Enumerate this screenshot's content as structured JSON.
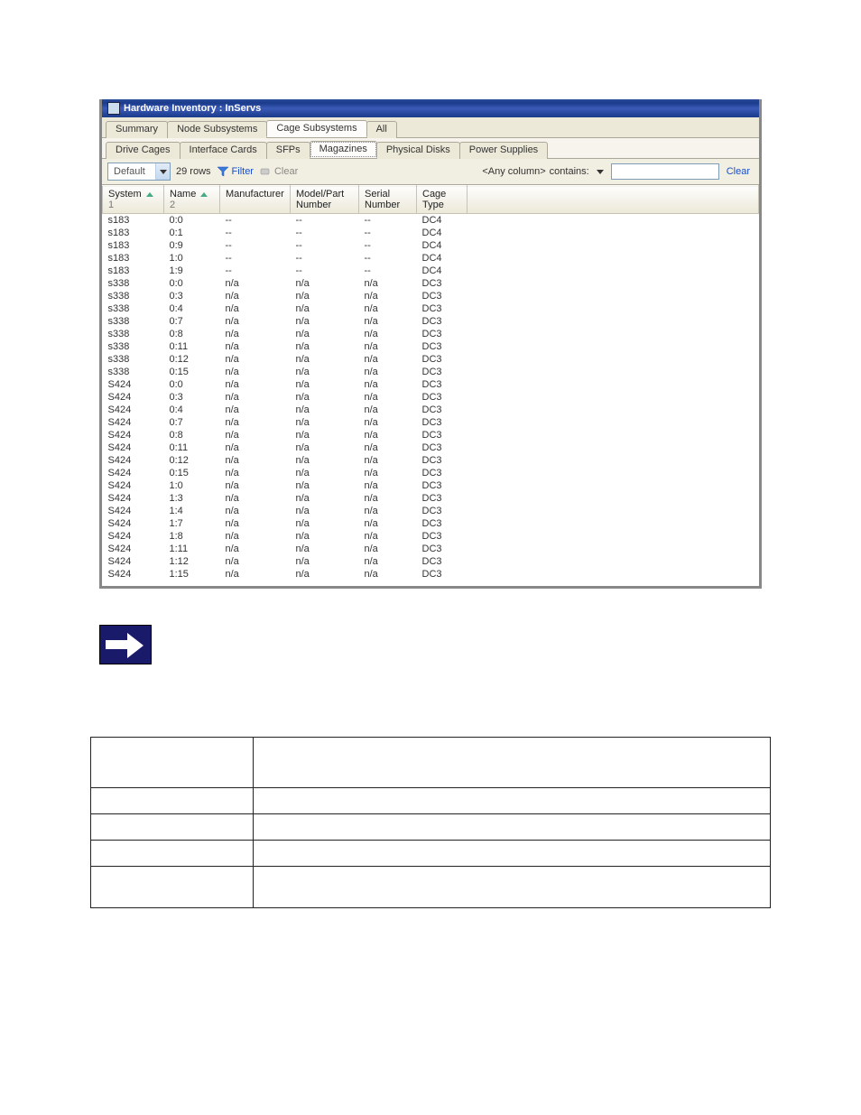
{
  "window": {
    "title": "Hardware Inventory : InServs"
  },
  "tabs1": {
    "items": [
      {
        "label": "Summary"
      },
      {
        "label": "Node Subsystems"
      },
      {
        "label": "Cage Subsystems"
      },
      {
        "label": "All"
      }
    ],
    "activeIndex": 2
  },
  "tabs2": {
    "items": [
      {
        "label": "Drive Cages"
      },
      {
        "label": "Interface Cards"
      },
      {
        "label": "SFPs"
      },
      {
        "label": "Magazines"
      },
      {
        "label": "Physical Disks"
      },
      {
        "label": "Power Supplies"
      }
    ],
    "activeIndex": 3
  },
  "toolbar": {
    "view": "Default",
    "rows_label": "29 rows",
    "filter_label": "Filter",
    "clear_label": "Clear",
    "filter_scope": "<Any column>",
    "filter_op": "contains:",
    "filter_value": "",
    "clear_link": "Clear"
  },
  "grid": {
    "columns": [
      {
        "label": "System",
        "sort": "1"
      },
      {
        "label": "Name",
        "sort": "2"
      },
      {
        "label": "Manufacturer"
      },
      {
        "label": "Model/Part Number"
      },
      {
        "label": "Serial Number"
      },
      {
        "label": "Cage Type"
      }
    ],
    "rows": [
      {
        "c": [
          "s183",
          "0:0",
          "--",
          "--",
          "--",
          "DC4"
        ]
      },
      {
        "c": [
          "s183",
          "0:1",
          "--",
          "--",
          "--",
          "DC4"
        ]
      },
      {
        "c": [
          "s183",
          "0:9",
          "--",
          "--",
          "--",
          "DC4"
        ]
      },
      {
        "c": [
          "s183",
          "1:0",
          "--",
          "--",
          "--",
          "DC4"
        ]
      },
      {
        "c": [
          "s183",
          "1:9",
          "--",
          "--",
          "--",
          "DC4"
        ]
      },
      {
        "c": [
          "s338",
          "0:0",
          "n/a",
          "n/a",
          "n/a",
          "DC3"
        ]
      },
      {
        "c": [
          "s338",
          "0:3",
          "n/a",
          "n/a",
          "n/a",
          "DC3"
        ]
      },
      {
        "c": [
          "s338",
          "0:4",
          "n/a",
          "n/a",
          "n/a",
          "DC3"
        ]
      },
      {
        "c": [
          "s338",
          "0:7",
          "n/a",
          "n/a",
          "n/a",
          "DC3"
        ]
      },
      {
        "c": [
          "s338",
          "0:8",
          "n/a",
          "n/a",
          "n/a",
          "DC3"
        ]
      },
      {
        "c": [
          "s338",
          "0:11",
          "n/a",
          "n/a",
          "n/a",
          "DC3"
        ]
      },
      {
        "c": [
          "s338",
          "0:12",
          "n/a",
          "n/a",
          "n/a",
          "DC3"
        ]
      },
      {
        "c": [
          "s338",
          "0:15",
          "n/a",
          "n/a",
          "n/a",
          "DC3"
        ]
      },
      {
        "c": [
          "S424",
          "0:0",
          "n/a",
          "n/a",
          "n/a",
          "DC3"
        ]
      },
      {
        "c": [
          "S424",
          "0:3",
          "n/a",
          "n/a",
          "n/a",
          "DC3"
        ]
      },
      {
        "c": [
          "S424",
          "0:4",
          "n/a",
          "n/a",
          "n/a",
          "DC3"
        ]
      },
      {
        "c": [
          "S424",
          "0:7",
          "n/a",
          "n/a",
          "n/a",
          "DC3"
        ]
      },
      {
        "c": [
          "S424",
          "0:8",
          "n/a",
          "n/a",
          "n/a",
          "DC3"
        ]
      },
      {
        "c": [
          "S424",
          "0:11",
          "n/a",
          "n/a",
          "n/a",
          "DC3"
        ]
      },
      {
        "c": [
          "S424",
          "0:12",
          "n/a",
          "n/a",
          "n/a",
          "DC3"
        ]
      },
      {
        "c": [
          "S424",
          "0:15",
          "n/a",
          "n/a",
          "n/a",
          "DC3"
        ]
      },
      {
        "c": [
          "S424",
          "1:0",
          "n/a",
          "n/a",
          "n/a",
          "DC3"
        ]
      },
      {
        "c": [
          "S424",
          "1:3",
          "n/a",
          "n/a",
          "n/a",
          "DC3"
        ]
      },
      {
        "c": [
          "S424",
          "1:4",
          "n/a",
          "n/a",
          "n/a",
          "DC3"
        ]
      },
      {
        "c": [
          "S424",
          "1:7",
          "n/a",
          "n/a",
          "n/a",
          "DC3"
        ]
      },
      {
        "c": [
          "S424",
          "1:8",
          "n/a",
          "n/a",
          "n/a",
          "DC3"
        ]
      },
      {
        "c": [
          "S424",
          "1:11",
          "n/a",
          "n/a",
          "n/a",
          "DC3"
        ]
      },
      {
        "c": [
          "S424",
          "1:12",
          "n/a",
          "n/a",
          "n/a",
          "DC3"
        ]
      },
      {
        "c": [
          "S424",
          "1:15",
          "n/a",
          "n/a",
          "n/a",
          "DC3"
        ]
      }
    ]
  },
  "desc": {
    "rows": [
      {
        "label": "",
        "value": ""
      },
      {
        "label": "",
        "value": ""
      },
      {
        "label": "",
        "value": ""
      },
      {
        "label": "",
        "value": ""
      },
      {
        "label": "",
        "value": ""
      }
    ]
  }
}
